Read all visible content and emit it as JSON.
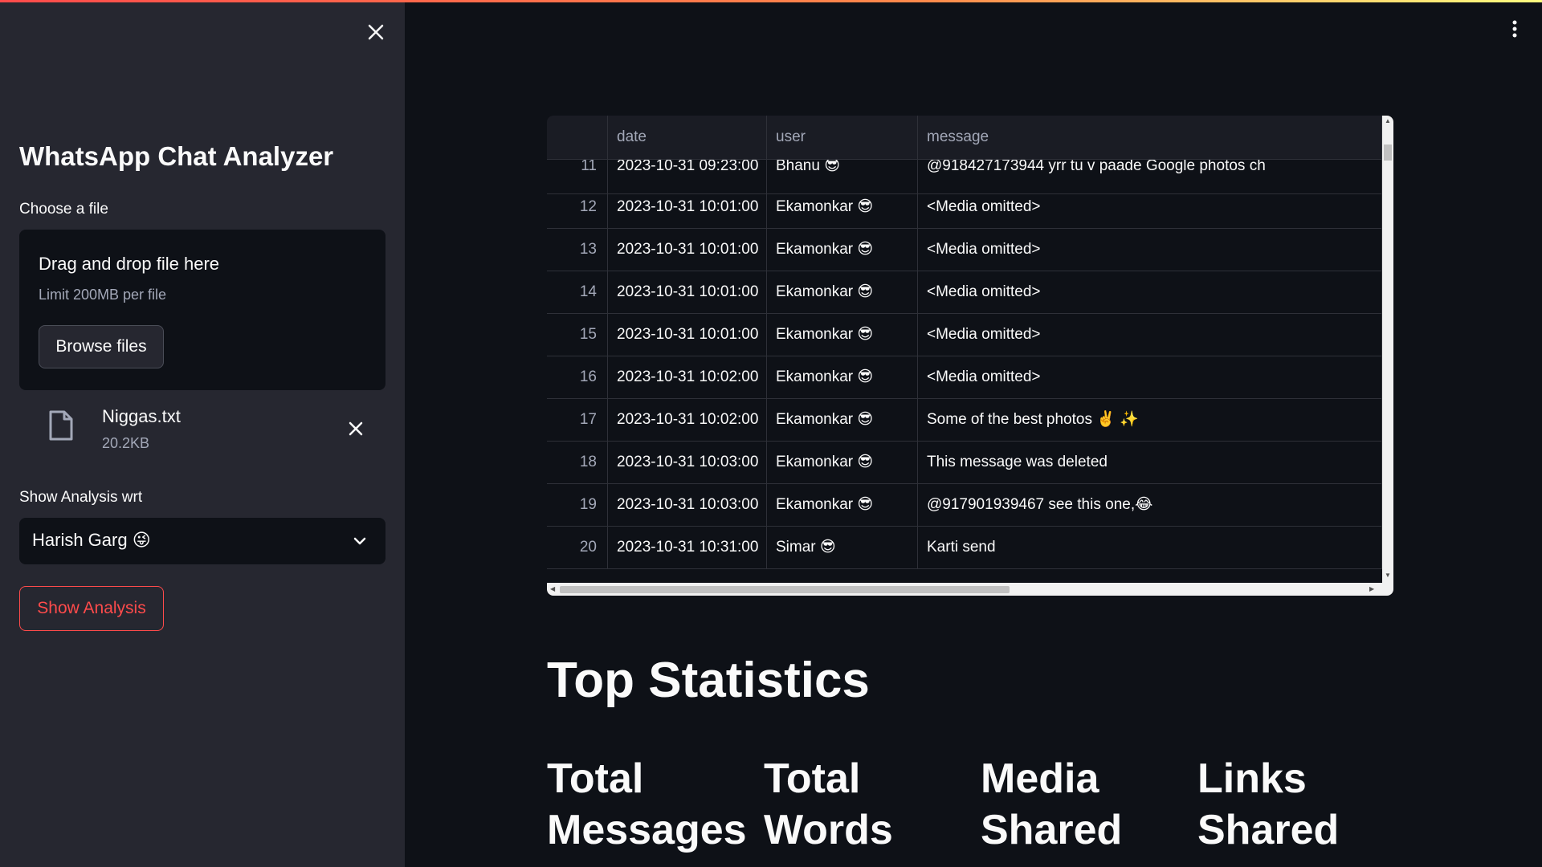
{
  "sidebar": {
    "title": "WhatsApp Chat Analyzer",
    "file_label": "Choose a file",
    "dropzone": {
      "title": "Drag and drop file here",
      "limit": "Limit 200MB per file",
      "browse_label": "Browse files"
    },
    "uploaded_file": {
      "name": "Niggas.txt",
      "size": "20.2KB"
    },
    "select_label": "Show Analysis wrt",
    "selected_user": "Harish Garg 😜",
    "show_button": "Show Analysis"
  },
  "table": {
    "columns": [
      "",
      "date",
      "user",
      "message"
    ],
    "rows": [
      {
        "idx": "11",
        "date": "2023-10-31 09:23:00",
        "user": "Bhanu 😎",
        "message": "@918427173944  yrr tu v paade Google photos ch"
      },
      {
        "idx": "12",
        "date": "2023-10-31 10:01:00",
        "user": "Ekamonkar 😎",
        "message": "<Media omitted>"
      },
      {
        "idx": "13",
        "date": "2023-10-31 10:01:00",
        "user": "Ekamonkar 😎",
        "message": "<Media omitted>"
      },
      {
        "idx": "14",
        "date": "2023-10-31 10:01:00",
        "user": "Ekamonkar 😎",
        "message": "<Media omitted>"
      },
      {
        "idx": "15",
        "date": "2023-10-31 10:01:00",
        "user": "Ekamonkar 😎",
        "message": "<Media omitted>"
      },
      {
        "idx": "16",
        "date": "2023-10-31 10:02:00",
        "user": "Ekamonkar 😎",
        "message": "<Media omitted>"
      },
      {
        "idx": "17",
        "date": "2023-10-31 10:02:00",
        "user": "Ekamonkar 😎",
        "message": "Some of the best photos ✌️ ✨"
      },
      {
        "idx": "18",
        "date": "2023-10-31 10:03:00",
        "user": "Ekamonkar 😎",
        "message": "This message was deleted"
      },
      {
        "idx": "19",
        "date": "2023-10-31 10:03:00",
        "user": "Ekamonkar 😎",
        "message": "@917901939467 see this one,😂"
      },
      {
        "idx": "20",
        "date": "2023-10-31 10:31:00",
        "user": "Simar 😎",
        "message": "Karti send"
      }
    ]
  },
  "main": {
    "section_title": "Top Statistics",
    "stats": [
      "Total Messages",
      "Total Words",
      "Media Shared",
      "Links Shared"
    ]
  },
  "colors": {
    "sidebar_bg": "#262730",
    "main_bg": "#0e1117",
    "accent": "#ff4b4b"
  },
  "icons": [
    "close-icon",
    "file-icon",
    "chevron-down-icon",
    "more-vertical-icon"
  ]
}
